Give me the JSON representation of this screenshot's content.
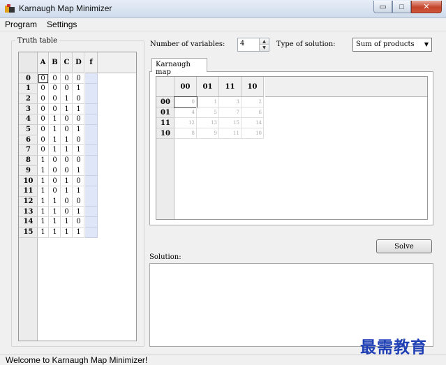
{
  "window": {
    "title": "Karnaugh Map Minimizer",
    "minimize": "▭",
    "maximize": "□",
    "close": "✕"
  },
  "menu": [
    "Program",
    "Settings"
  ],
  "truth_table": {
    "label": "Truth table",
    "headers": [
      "A",
      "B",
      "C",
      "D",
      "f"
    ],
    "rows": [
      {
        "index": "0",
        "bits": [
          "0",
          "0",
          "0",
          "0"
        ]
      },
      {
        "index": "1",
        "bits": [
          "0",
          "0",
          "0",
          "1"
        ]
      },
      {
        "index": "2",
        "bits": [
          "0",
          "0",
          "1",
          "0"
        ]
      },
      {
        "index": "3",
        "bits": [
          "0",
          "0",
          "1",
          "1"
        ]
      },
      {
        "index": "4",
        "bits": [
          "0",
          "1",
          "0",
          "0"
        ]
      },
      {
        "index": "5",
        "bits": [
          "0",
          "1",
          "0",
          "1"
        ]
      },
      {
        "index": "6",
        "bits": [
          "0",
          "1",
          "1",
          "0"
        ]
      },
      {
        "index": "7",
        "bits": [
          "0",
          "1",
          "1",
          "1"
        ]
      },
      {
        "index": "8",
        "bits": [
          "1",
          "0",
          "0",
          "0"
        ]
      },
      {
        "index": "9",
        "bits": [
          "1",
          "0",
          "0",
          "1"
        ]
      },
      {
        "index": "10",
        "bits": [
          "1",
          "0",
          "1",
          "0"
        ]
      },
      {
        "index": "11",
        "bits": [
          "1",
          "0",
          "1",
          "1"
        ]
      },
      {
        "index": "12",
        "bits": [
          "1",
          "1",
          "0",
          "0"
        ]
      },
      {
        "index": "13",
        "bits": [
          "1",
          "1",
          "0",
          "1"
        ]
      },
      {
        "index": "14",
        "bits": [
          "1",
          "1",
          "1",
          "0"
        ]
      },
      {
        "index": "15",
        "bits": [
          "1",
          "1",
          "1",
          "1"
        ]
      }
    ]
  },
  "controls": {
    "num_vars_label": "Number of variables:",
    "num_vars_value": "4",
    "solution_type_label": "Type of solution:",
    "solution_type_value": "Sum of products"
  },
  "kmap": {
    "tab_label": "Karnaugh map",
    "col_headers": [
      "00",
      "01",
      "11",
      "10"
    ],
    "row_headers": [
      "00",
      "01",
      "11",
      "10"
    ],
    "cells": [
      [
        "0",
        "1",
        "3",
        "2"
      ],
      [
        "4",
        "5",
        "7",
        "6"
      ],
      [
        "12",
        "13",
        "15",
        "14"
      ],
      [
        "8",
        "9",
        "11",
        "10"
      ]
    ]
  },
  "solve_label": "Solve",
  "solution_label": "Solution:",
  "status": "Welcome to Karnaugh Map Minimizer!",
  "watermark": "最需教育",
  "colors": {
    "f_column": "#dfe6f7",
    "close_button": "#c3432a",
    "watermark": "#1f3fb5"
  }
}
